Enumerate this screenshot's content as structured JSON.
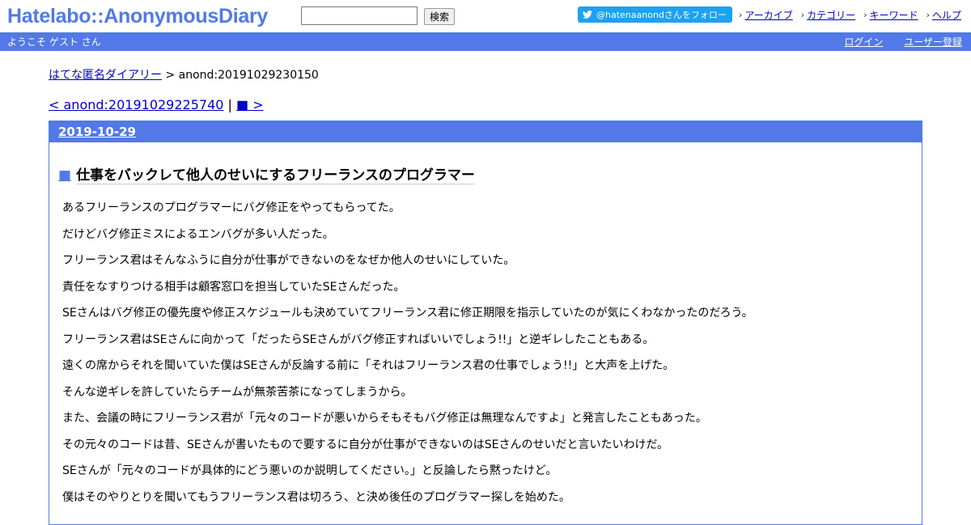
{
  "header": {
    "logo": "Hatelabo::AnonymousDiary",
    "search_placeholder": "",
    "search_button": "検索",
    "follow_label": "@hatenaanondさんをフォロー",
    "nav": [
      "アーカイブ",
      "カテゴリー",
      "キーワード",
      "ヘルプ"
    ]
  },
  "userbar": {
    "welcome": "ようこそ ゲスト さん",
    "login": "ログイン",
    "register": "ユーザー登録"
  },
  "breadcrumb": {
    "home": "はてな匿名ダイアリー",
    "separator": ">",
    "current": "anond:20191029230150"
  },
  "pager": {
    "prev": "< anond:20191029225740",
    "separator": "|",
    "next": "■ >"
  },
  "day": {
    "date": "2019-10-29",
    "entry_marker": "■",
    "entry_title": "仕事をバックレて他人のせいにするフリーランスのプログラマー",
    "paragraphs": [
      "あるフリーランスのプログラマーにバグ修正をやってもらってた。",
      "だけどバグ修正ミスによるエンバグが多い人だった。",
      "フリーランス君はそんなふうに自分が仕事ができないのをなぜか他人のせいにしていた。",
      "責任をなすりつける相手は顧客窓口を担当していたSEさんだった。",
      "SEさんはバグ修正の優先度や修正スケジュールも決めていてフリーランス君に修正期限を指示していたのが気にくわなかったのだろう。",
      "フリーランス君はSEさんに向かって「だったらSEさんがバグ修正すればいいでしょう!!」と逆ギレしたこともある。",
      "遠くの席からそれを聞いていた僕はSEさんが反論する前に「それはフリーランス君の仕事でしょう!!」と大声を上げた。",
      "そんな逆ギレを許していたらチームが無茶苦茶になってしまうから。",
      "また、会議の時にフリーランス君が「元々のコードが悪いからそもそもバグ修正は無理なんですよ」と発言したこともあった。",
      "その元々のコードは昔、SEさんが書いたもので要するに自分が仕事ができないのはSEさんのせいだと言いたいわけだ。",
      "SEさんが「元々のコードが具体的にどう悪いのか説明してください。」と反論したら黙ったけど。",
      "僕はそのやりとりを聞いてもうフリーランス君は切ろう、と決め後任のプログラマー探しを始めた。"
    ]
  },
  "colors": {
    "brand": "#5279e7",
    "twitter": "#1da1f2",
    "link": "#0000cc"
  },
  "icons": {
    "follow": "twitter-bird-icon",
    "nav": "chevron-right-icon"
  }
}
